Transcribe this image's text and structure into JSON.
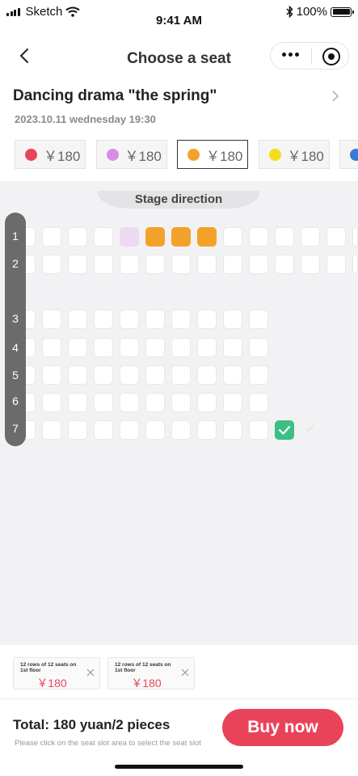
{
  "status_bar": {
    "carrier": "Sketch",
    "time": "9:41 AM",
    "battery": "100%"
  },
  "nav": {
    "title": "Choose a seat"
  },
  "show": {
    "title": "Dancing drama \"the spring\"",
    "datetime": "2023.10.11 wednesday 19:30"
  },
  "price_tiers": [
    {
      "label": "￥180",
      "color": "#e6455a",
      "selected": false
    },
    {
      "label": "￥180",
      "color": "#d98ee6",
      "selected": false
    },
    {
      "label": "￥180",
      "color": "#f3a229",
      "selected": true
    },
    {
      "label": "￥180",
      "color": "#f4dd1a",
      "selected": false
    },
    {
      "label": "￥180",
      "color": "#3a7bd5",
      "selected": false
    }
  ],
  "seat_map": {
    "stage_label": "Stage direction",
    "rows": [
      "1",
      "2",
      "3",
      "4",
      "5",
      "6",
      "7"
    ],
    "seat_colors": {
      "lilac": "#ecd9f2",
      "orange": "#f3a229",
      "green": "#3bbf85"
    }
  },
  "selected_tickets": [
    {
      "description": "12 rows of 12 seats on 1st floor",
      "price": "￥180"
    },
    {
      "description": "12 rows of 12 seats on 1st floor",
      "price": "￥180"
    }
  ],
  "footer": {
    "total": "Total: 180 yuan/2 pieces",
    "hint": "Please click on the seat slot area to select the seat slot",
    "buy_label": "Buy now"
  }
}
